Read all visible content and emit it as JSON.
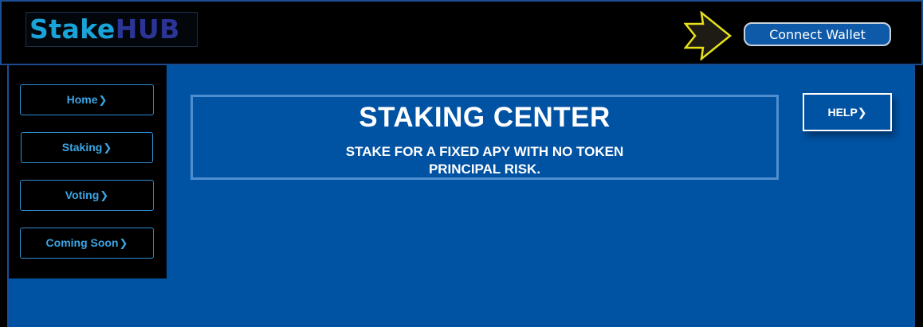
{
  "header": {
    "logo_part1": "Stake",
    "logo_part2": "HUB",
    "connect_wallet": "Connect Wallet"
  },
  "sidebar": {
    "items": [
      {
        "label": "Home"
      },
      {
        "label": "Staking"
      },
      {
        "label": "Voting"
      },
      {
        "label": "Coming Soon"
      }
    ],
    "chevron": "❯"
  },
  "hero": {
    "title": "STAKING CENTER",
    "subtitle_line1": "STAKE FOR A FIXED APY WITH NO TOKEN",
    "subtitle_line2": "PRINCIPAL RISK."
  },
  "help": {
    "label": "HELP"
  },
  "icons": {
    "pointer_arrow": "arrow-right-icon",
    "chevron": "chevron-right-icon"
  },
  "colors": {
    "background": "#0052a3",
    "header_bg": "#000000",
    "accent": "#1aa3d9",
    "logo_hub": "#2c3597",
    "nav_text": "#3aa6e6",
    "arrow_fill": "#1e1a14",
    "arrow_stroke": "#e6e21a"
  }
}
